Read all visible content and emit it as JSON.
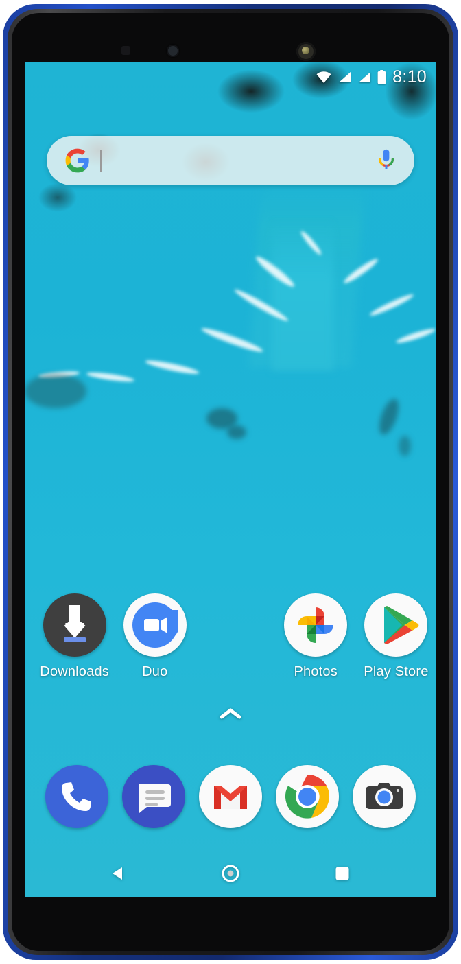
{
  "device": {
    "name": "android-smartphone",
    "frame_color": "#1b3fa0",
    "bezel_color": "#0a0a0b",
    "sensors": [
      "ir-sensor",
      "proximity-camera",
      "front-camera"
    ]
  },
  "status_bar": {
    "time": "8:10",
    "icons": [
      "wifi-icon",
      "signal-sim1-icon",
      "signal-sim2-icon",
      "battery-icon"
    ],
    "battery_level": "full",
    "wifi_label": "wifi-icon",
    "signal_label": "cellular-signal-icon",
    "battery_label": "battery-icon"
  },
  "search": {
    "placeholder": "",
    "value": "",
    "google_logo": "google-g-icon",
    "mic": "microphone-icon"
  },
  "home_screen": {
    "wallpaper": "aerial-coastline-wallpaper",
    "wallpaper_colors": {
      "rock": "#7a3e1d",
      "water": "#1fb4d4",
      "foam": "#ffffff"
    },
    "apps": [
      {
        "label": "Downloads",
        "icon": "downloads-icon",
        "color": "#3f3f3f"
      },
      {
        "label": "Duo",
        "icon": "duo-icon",
        "color": "#3c64d8"
      },
      {
        "label": "",
        "icon": "",
        "color": ""
      },
      {
        "label": "Photos",
        "icon": "photos-icon",
        "color": "#fafafa"
      },
      {
        "label": "Play Store",
        "icon": "play-store-icon",
        "color": "#fafafa"
      }
    ],
    "drawer_handle": "chevron-up-icon"
  },
  "dock": {
    "items": [
      {
        "label": "Phone",
        "icon": "phone-icon",
        "color": "#3c64d8"
      },
      {
        "label": "Messages",
        "icon": "messages-icon",
        "color": "#3b4fc4"
      },
      {
        "label": "Gmail",
        "icon": "gmail-icon",
        "color": "#fafafa"
      },
      {
        "label": "Chrome",
        "icon": "chrome-icon",
        "color": "#fafafa"
      },
      {
        "label": "Camera",
        "icon": "camera-icon",
        "color": "#fafafa"
      }
    ]
  },
  "nav_bar": {
    "back": "back-triangle-icon",
    "home": "home-circle-icon",
    "recents": "recents-square-icon"
  }
}
